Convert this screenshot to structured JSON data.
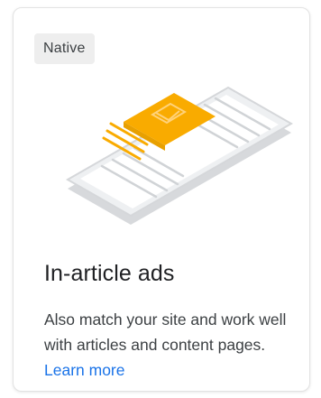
{
  "card": {
    "badge": "Native",
    "title": "In-article ads",
    "description": "Also match your site and work well with articles and content pages.",
    "learn_more": "Learn more",
    "illustration_icon": "in-article-phone-illustration",
    "accent_color": "#f9ab00",
    "link_color": "#1a73e8"
  }
}
